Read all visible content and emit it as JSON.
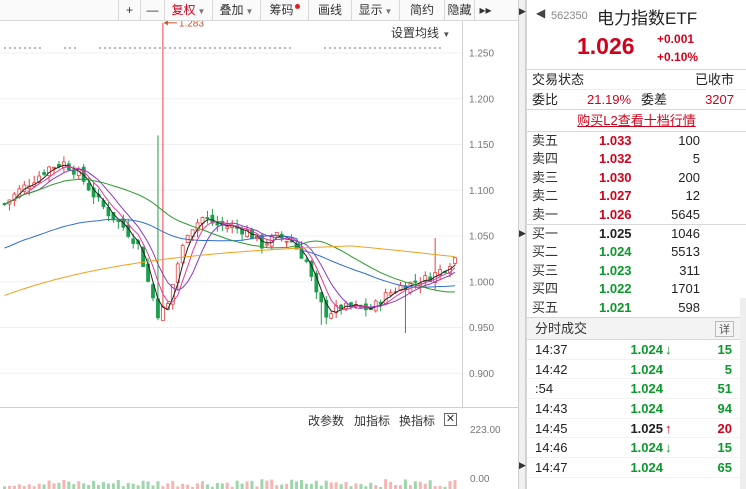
{
  "toolbar": {
    "items": [
      {
        "label": "+",
        "name": "zoom-in-button"
      },
      {
        "label": "—",
        "name": "zoom-out-button"
      },
      {
        "label": "复权",
        "name": "adjust-dropdown",
        "caret": true,
        "active": true
      },
      {
        "label": "叠加",
        "name": "overlay-dropdown",
        "caret": true
      },
      {
        "label": "筹码",
        "name": "chips-button",
        "dot": true
      },
      {
        "label": "画线",
        "name": "draw-line-button"
      },
      {
        "label": "显示",
        "name": "display-dropdown",
        "caret": true
      },
      {
        "label": "简约",
        "name": "simple-button"
      },
      {
        "label": "隐藏",
        "name": "hide-button"
      },
      {
        "label": "▸▸",
        "name": "more-icon"
      }
    ]
  },
  "ma_settings": "设置均线",
  "chart_data": {
    "type": "candlestick",
    "y_ticks": [
      "1.250",
      "1.200",
      "1.150",
      "1.100",
      "1.050",
      "1.000",
      "0.950",
      "0.900"
    ],
    "y_tick_values": [
      1.25,
      1.2,
      1.15,
      1.1,
      1.05,
      1.0,
      0.95,
      0.9
    ],
    "ylim": [
      0.885,
      1.285
    ],
    "max_annotation": "1.283",
    "max_value": 1.283,
    "volume_max_label": "223.00",
    "volume_min_label": "0.00",
    "colors": {
      "up": "#e8413e",
      "down": "#1aa04a",
      "ma_short": "#222222",
      "ma_mid1": "#e6379f",
      "ma_mid2": "#8a38c9",
      "ma_long1": "#2f6fd6",
      "ma_long2": "#2a9a2a",
      "ma_longest": "#f0a020"
    }
  },
  "indicators": {
    "modify": "改参数",
    "add": "加指标",
    "switch": "换指标",
    "close": "✕"
  },
  "quote": {
    "back": "◀",
    "code": "562350",
    "name": "电力指数ETF",
    "price": "1.026",
    "change": "+0.001",
    "change_pct": "+0.10%",
    "status_label": "交易状态",
    "status_value": "已收市",
    "ratio_label": "委比",
    "ratio_value": "21.19%",
    "diff_label": "委差",
    "diff_value": "3207",
    "l2_link": "购买L2查看十档行情",
    "asks": [
      {
        "label": "卖五",
        "price": "1.033",
        "vol": "100"
      },
      {
        "label": "卖四",
        "price": "1.032",
        "vol": "5"
      },
      {
        "label": "卖三",
        "price": "1.030",
        "vol": "200"
      },
      {
        "label": "卖二",
        "price": "1.027",
        "vol": "12"
      },
      {
        "label": "卖一",
        "price": "1.026",
        "vol": "5645"
      }
    ],
    "bids": [
      {
        "label": "买一",
        "price": "1.025",
        "vol": "1046",
        "color": "black"
      },
      {
        "label": "买二",
        "price": "1.024",
        "vol": "5513",
        "color": "green"
      },
      {
        "label": "买三",
        "price": "1.023",
        "vol": "311",
        "color": "green"
      },
      {
        "label": "买四",
        "price": "1.022",
        "vol": "1701",
        "color": "green"
      },
      {
        "label": "买五",
        "price": "1.021",
        "vol": "598",
        "color": "green"
      }
    ],
    "ticks_title": "分时成交",
    "ticks_detail": "详",
    "ticks": [
      {
        "time": "14:37",
        "price": "1.024",
        "arrow": "down",
        "vol": "15"
      },
      {
        "time": "14:42",
        "price": "1.024",
        "arrow": "",
        "vol": "5"
      },
      {
        "time": ":54",
        "price": "1.024",
        "arrow": "",
        "vol": "51"
      },
      {
        "time": "14:43",
        "price": "1.024",
        "arrow": "",
        "vol": "94"
      },
      {
        "time": "14:45",
        "price": "1.025",
        "arrow": "up",
        "vol": "20"
      },
      {
        "time": "14:46",
        "price": "1.024",
        "arrow": "down",
        "vol": "15"
      },
      {
        "time": "14:47",
        "price": "1.024",
        "arrow": "",
        "vol": "65"
      }
    ]
  }
}
